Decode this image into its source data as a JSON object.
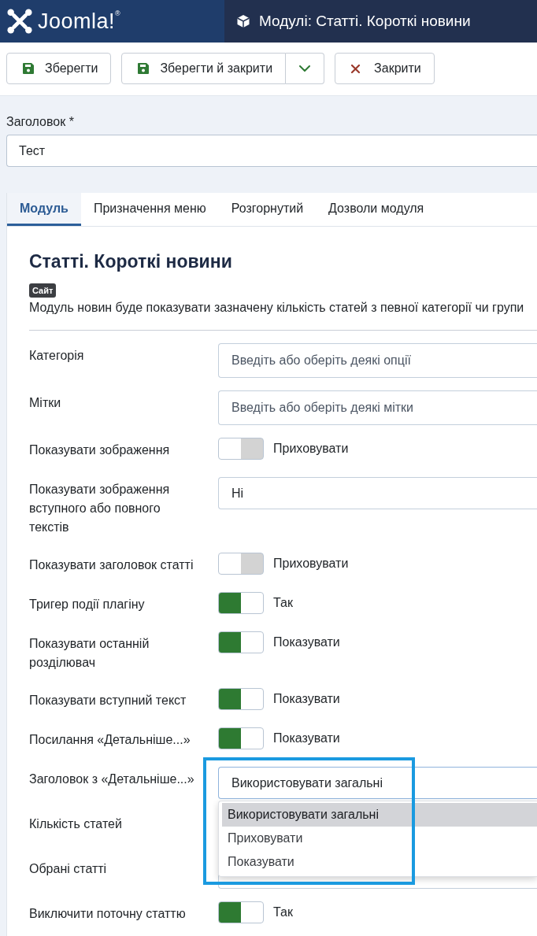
{
  "header": {
    "logo": "Joomla!$^{®}$",
    "title": "Модулі: Статті. Короткі новини"
  },
  "toolbar": {
    "buttons": [
      {
        "kind": "save",
        "label": "Зберегти"
      },
      {
        "kind": "save-split",
        "label": "Зберегти й закрити"
      },
      {
        "kind": "close",
        "label": "Закрити"
      }
    ]
  },
  "title_field": {
    "label": "Заголовок *",
    "value": "Тест"
  },
  "tabs": [
    {
      "label": "Модуль",
      "selected": true
    },
    {
      "label": "Призначення меню",
      "selected": false
    },
    {
      "label": "Розгорнутий",
      "selected": false
    },
    {
      "label": "Дозволи модуля",
      "selected": false
    }
  ],
  "module": {
    "heading": "Статті. Короткі новини",
    "badge": "Сайт",
    "description": "Модуль новин буде показувати зазначену кількість статей з певної категорії чи групи"
  },
  "fields": [
    {
      "kind": "multiselect",
      "label": "Категорія",
      "placeholder": "Введіть або оберіть деякі опції"
    },
    {
      "kind": "multiselect",
      "label": "Мітки",
      "placeholder": "Введіть або оберіть деякі мітки"
    },
    {
      "kind": "toggle",
      "label": "Показувати зображення",
      "on": false,
      "state_label": "Приховувати"
    },
    {
      "kind": "select",
      "label": "Показувати зображення вступного або повного текстів",
      "value": "Ні"
    },
    {
      "kind": "toggle",
      "label": "Показувати заголовок статті",
      "on": false,
      "state_label": "Приховувати"
    },
    {
      "kind": "toggle",
      "label": "Тригер події плагіну",
      "on": true,
      "state_label": "Так"
    },
    {
      "kind": "toggle",
      "label": "Показувати останній розділювач",
      "on": true,
      "state_label": "Показувати"
    },
    {
      "kind": "toggle",
      "label": "Показувати вступний текст",
      "on": true,
      "state_label": "Показувати"
    },
    {
      "kind": "toggle",
      "label": "Посилання «Детальніше...»",
      "on": true,
      "state_label": "Показувати"
    },
    {
      "kind": "select",
      "label": "Заголовок з «Детальніше...»",
      "value": "Використовувати загальні",
      "expanded": true,
      "highlighted": true,
      "options": [
        {
          "label": "Використовувати загальні",
          "selected": true
        },
        {
          "label": "Приховувати",
          "selected": false
        },
        {
          "label": "Показувати",
          "selected": false
        }
      ]
    },
    {
      "kind": "covered",
      "label": "Кількість статей"
    },
    {
      "kind": "select",
      "label": "Обрані статті"
    },
    {
      "kind": "toggle",
      "label": "Виключити поточну статтю",
      "on": true,
      "state_label": "Так"
    }
  ]
}
